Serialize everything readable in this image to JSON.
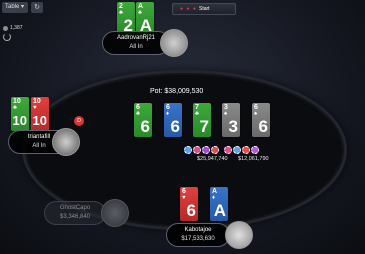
{
  "toolbar": {
    "table_menu_label": "Table",
    "refresh_icon": "refresh-icon",
    "start_label": "Start"
  },
  "balance": {
    "value": "1,387"
  },
  "players": {
    "top": {
      "name": "AadrovanRj21",
      "status": "All In",
      "cards": [
        {
          "rank": "2",
          "suit": "♣",
          "color": "green"
        },
        {
          "rank": "A",
          "suit": "♣",
          "color": "green"
        }
      ]
    },
    "left": {
      "name": "triantafill",
      "status": "All In",
      "cards": [
        {
          "rank": "10",
          "suit": "♣",
          "color": "green"
        },
        {
          "rank": "10",
          "suit": "♥",
          "color": "red"
        }
      ]
    },
    "bottom_left": {
      "name": "GhostCapo",
      "stack": "$3,346,840"
    },
    "hero": {
      "name": "Kabotajoe",
      "stack": "$17,533,630",
      "cards": [
        {
          "rank": "6",
          "suit": "♥",
          "color": "red"
        },
        {
          "rank": "A",
          "suit": "♦",
          "color": "blue"
        }
      ]
    }
  },
  "board": {
    "pot": "Pot: $38,009,530",
    "cards": [
      {
        "rank": "6",
        "suit": "♣",
        "color": "green"
      },
      {
        "rank": "6",
        "suit": "♦",
        "color": "blue"
      },
      {
        "rank": "7",
        "suit": "♣",
        "color": "green"
      },
      {
        "rank": "3",
        "suit": "♠",
        "color": "gray"
      },
      {
        "rank": "6",
        "suit": "♠",
        "color": "gray"
      }
    ],
    "side_pots": [
      "$25,947,740",
      "$12,061,790"
    ]
  }
}
